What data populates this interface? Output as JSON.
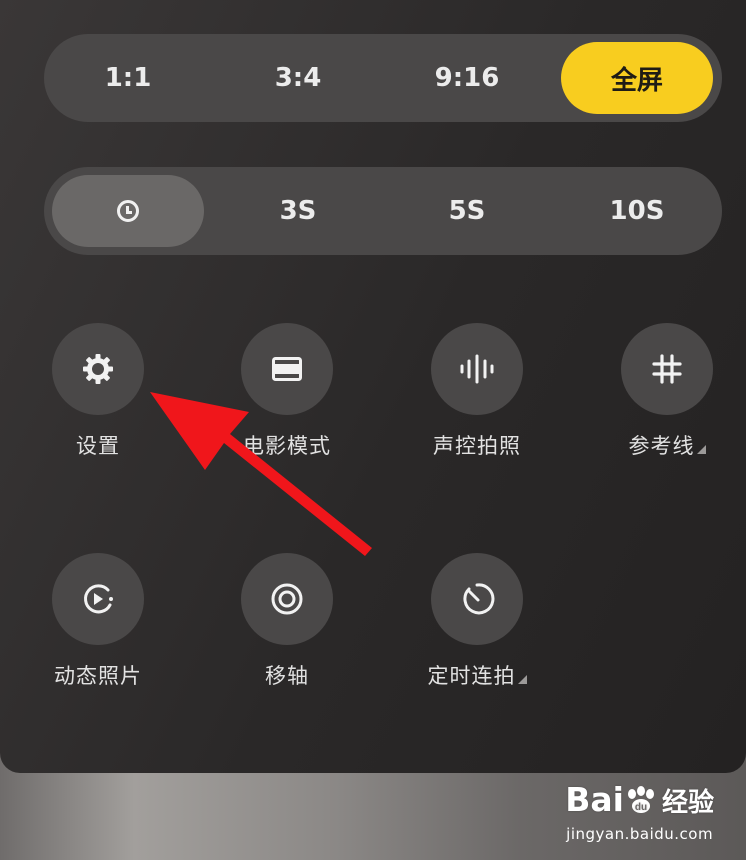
{
  "aspect_ratio": {
    "options": [
      "1:1",
      "3:4",
      "9:16",
      "全屏"
    ],
    "selected": "全屏",
    "accent_color": "#f8cd1f"
  },
  "timer": {
    "options": [
      {
        "icon": "clock-icon",
        "label": ""
      },
      {
        "icon": null,
        "label": "3S"
      },
      {
        "icon": null,
        "label": "5S"
      },
      {
        "icon": null,
        "label": "10S"
      }
    ],
    "selected_icon": "clock-icon"
  },
  "tools": [
    {
      "label": "设置",
      "icon": "gear-icon",
      "has_more": false
    },
    {
      "label": "电影模式",
      "icon": "cinema-frame-icon",
      "has_more": false
    },
    {
      "label": "声控拍照",
      "icon": "sound-wave-icon",
      "has_more": false
    },
    {
      "label": "参考线",
      "icon": "grid-hash-icon",
      "has_more": true
    },
    {
      "label": "动态照片",
      "icon": "motion-photo-icon",
      "has_more": false
    },
    {
      "label": "移轴",
      "icon": "tilt-shift-icon",
      "has_more": false
    },
    {
      "label": "定时连拍",
      "icon": "timer-burst-icon",
      "has_more": true
    }
  ],
  "annotation": {
    "arrow_color": "#f0161b",
    "points_to": "设置"
  },
  "watermark": {
    "logo_text": "Bai",
    "logo_suffix": "经验",
    "url": "jingyan.baidu.com"
  }
}
